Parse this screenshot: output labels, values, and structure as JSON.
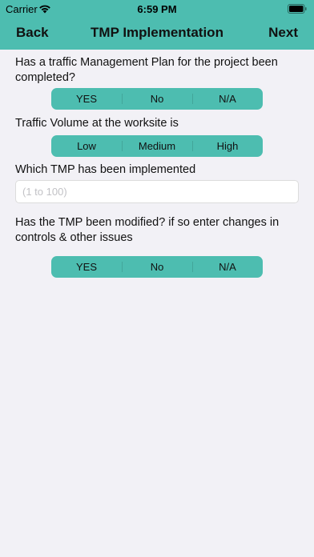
{
  "status_bar": {
    "carrier": "Carrier",
    "time": "6:59 PM",
    "wifi_icon": "wifi-icon",
    "battery_icon": "battery-icon"
  },
  "nav": {
    "back_label": "Back",
    "title": "TMP Implementation",
    "next_label": "Next"
  },
  "colors": {
    "accent": "#4dbdb0",
    "background": "#f2f1f6"
  },
  "form": {
    "q1": {
      "label": "Has a traffic Management Plan for the project been completed?",
      "options": [
        "YES",
        "No",
        "N/A"
      ]
    },
    "q2": {
      "label": "Traffic Volume at the worksite is",
      "options": [
        "Low",
        "Medium",
        "High"
      ]
    },
    "q3": {
      "label": "Which TMP has been implemented",
      "value": "",
      "placeholder": "(1 to 100)"
    },
    "q4": {
      "label": "Has the TMP been modified? if so enter changes in controls & other issues",
      "options": [
        "YES",
        "No",
        "N/A"
      ]
    }
  }
}
